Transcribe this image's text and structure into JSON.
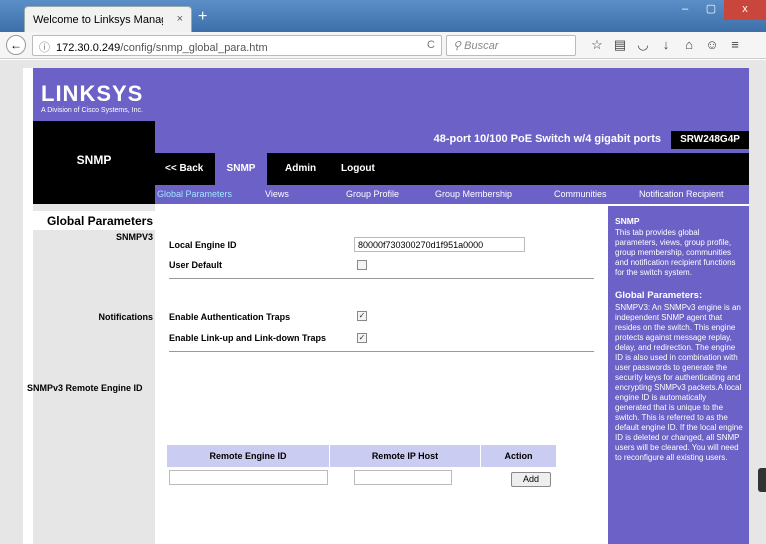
{
  "browser": {
    "tab_title": "Welcome to Linksys Managed ...",
    "tab_close": "×",
    "new_tab": "+",
    "url_host": "172.30.0.249",
    "url_path": "/config/snmp_global_para.htm",
    "search_placeholder": "Buscar",
    "window_buttons": {
      "minimize": "–",
      "maximize": "▢",
      "close": "x"
    }
  },
  "logo": {
    "main": "LINKSYS",
    "sub": "A Division of Cisco Systems, Inc."
  },
  "page_section": "SNMP",
  "product": {
    "description": "48-port 10/100 PoE Switch w/4 gigabit ports",
    "model": "SRW248G4P"
  },
  "nav": {
    "back": "<< Back",
    "snmp": "SNMP",
    "admin": "Admin",
    "logout": "Logout"
  },
  "subnav": {
    "global_parameters": "Global Parameters",
    "views": "Views",
    "group_profile": "Group Profile",
    "group_membership": "Group Membership",
    "communities": "Communities",
    "notification_recipient": "Notification Recipient"
  },
  "left": {
    "section_title": "Global Parameters",
    "snmpv3": "SNMPV3",
    "notifications": "Notifications",
    "remote_engine": "SNMPv3 Remote Engine ID"
  },
  "form": {
    "local_engine_label": "Local Engine ID",
    "local_engine_value": "80000f730300270d1f951a0000",
    "user_default_label": "User Default",
    "user_default_checked": false,
    "auth_traps_label": "Enable Authentication Traps",
    "auth_traps_checked": true,
    "link_traps_label": "Enable Link-up and Link-down Traps",
    "link_traps_checked": true
  },
  "remote_table": {
    "headers": [
      "Remote Engine ID",
      "Remote IP Host",
      "Action"
    ],
    "engine_id_value": "",
    "ip_host_value": "",
    "add_label": "Add"
  },
  "help": {
    "title": "SNMP",
    "intro": "This tab provides global parameters, views, group profile, group membership, communities and notification recipient functions for the switch system.",
    "subtitle": "Global Parameters:",
    "body": "SNMPV3: An SNMPv3 engine is an independent SNMP agent that resides on the switch. This engine protects against message replay, delay, and redirection. The engine ID is also used in combination with user passwords to generate the security keys for authenticating and encrypting SNMPv3 packets.A local engine ID is automatically generated that is unique to the switch. This is referred to as the default engine ID. If the local engine ID is deleted or changed, all SNMP users will be cleared. You will need to reconfigure all existing users."
  },
  "colors": {
    "purple": "#6b61c6",
    "table_header": "#cbccf1",
    "subnav_active": "#9fe6ff"
  }
}
